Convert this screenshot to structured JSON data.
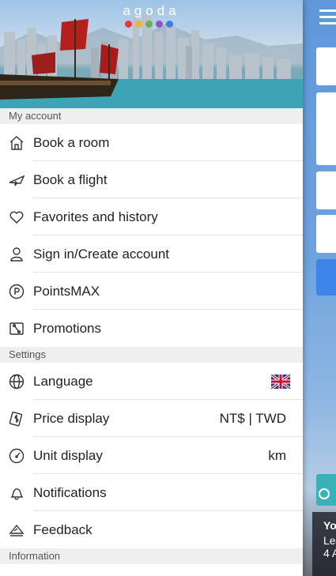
{
  "app": {
    "logo_text": "agoda",
    "logo_dot_colors": [
      "#e8393f",
      "#f3b23c",
      "#6ab24d",
      "#8a57c4",
      "#3d7fd9"
    ]
  },
  "sections": {
    "account": "My account",
    "settings": "Settings",
    "information": "Information"
  },
  "account_items": [
    {
      "label": "Book a room",
      "icon": "home-icon"
    },
    {
      "label": "Book a flight",
      "icon": "plane-icon"
    },
    {
      "label": "Favorites and history",
      "icon": "heart-icon"
    },
    {
      "label": "Sign in/Create account",
      "icon": "user-icon"
    },
    {
      "label": "PointsMAX",
      "icon": "points-icon"
    },
    {
      "label": "Promotions",
      "icon": "tag-icon"
    }
  ],
  "settings_items": [
    {
      "label": "Language",
      "icon": "globe-icon",
      "value_icon": "uk-flag-icon"
    },
    {
      "label": "Price display",
      "icon": "money-icon",
      "value": "NT$ | TWD"
    },
    {
      "label": "Unit display",
      "icon": "gauge-icon",
      "value": "km"
    },
    {
      "label": "Notifications",
      "icon": "bell-icon"
    },
    {
      "label": "Feedback",
      "icon": "feedback-icon"
    }
  ],
  "background_panel": {
    "line1": "Yo",
    "line2": "Le",
    "line3": "4 A"
  }
}
